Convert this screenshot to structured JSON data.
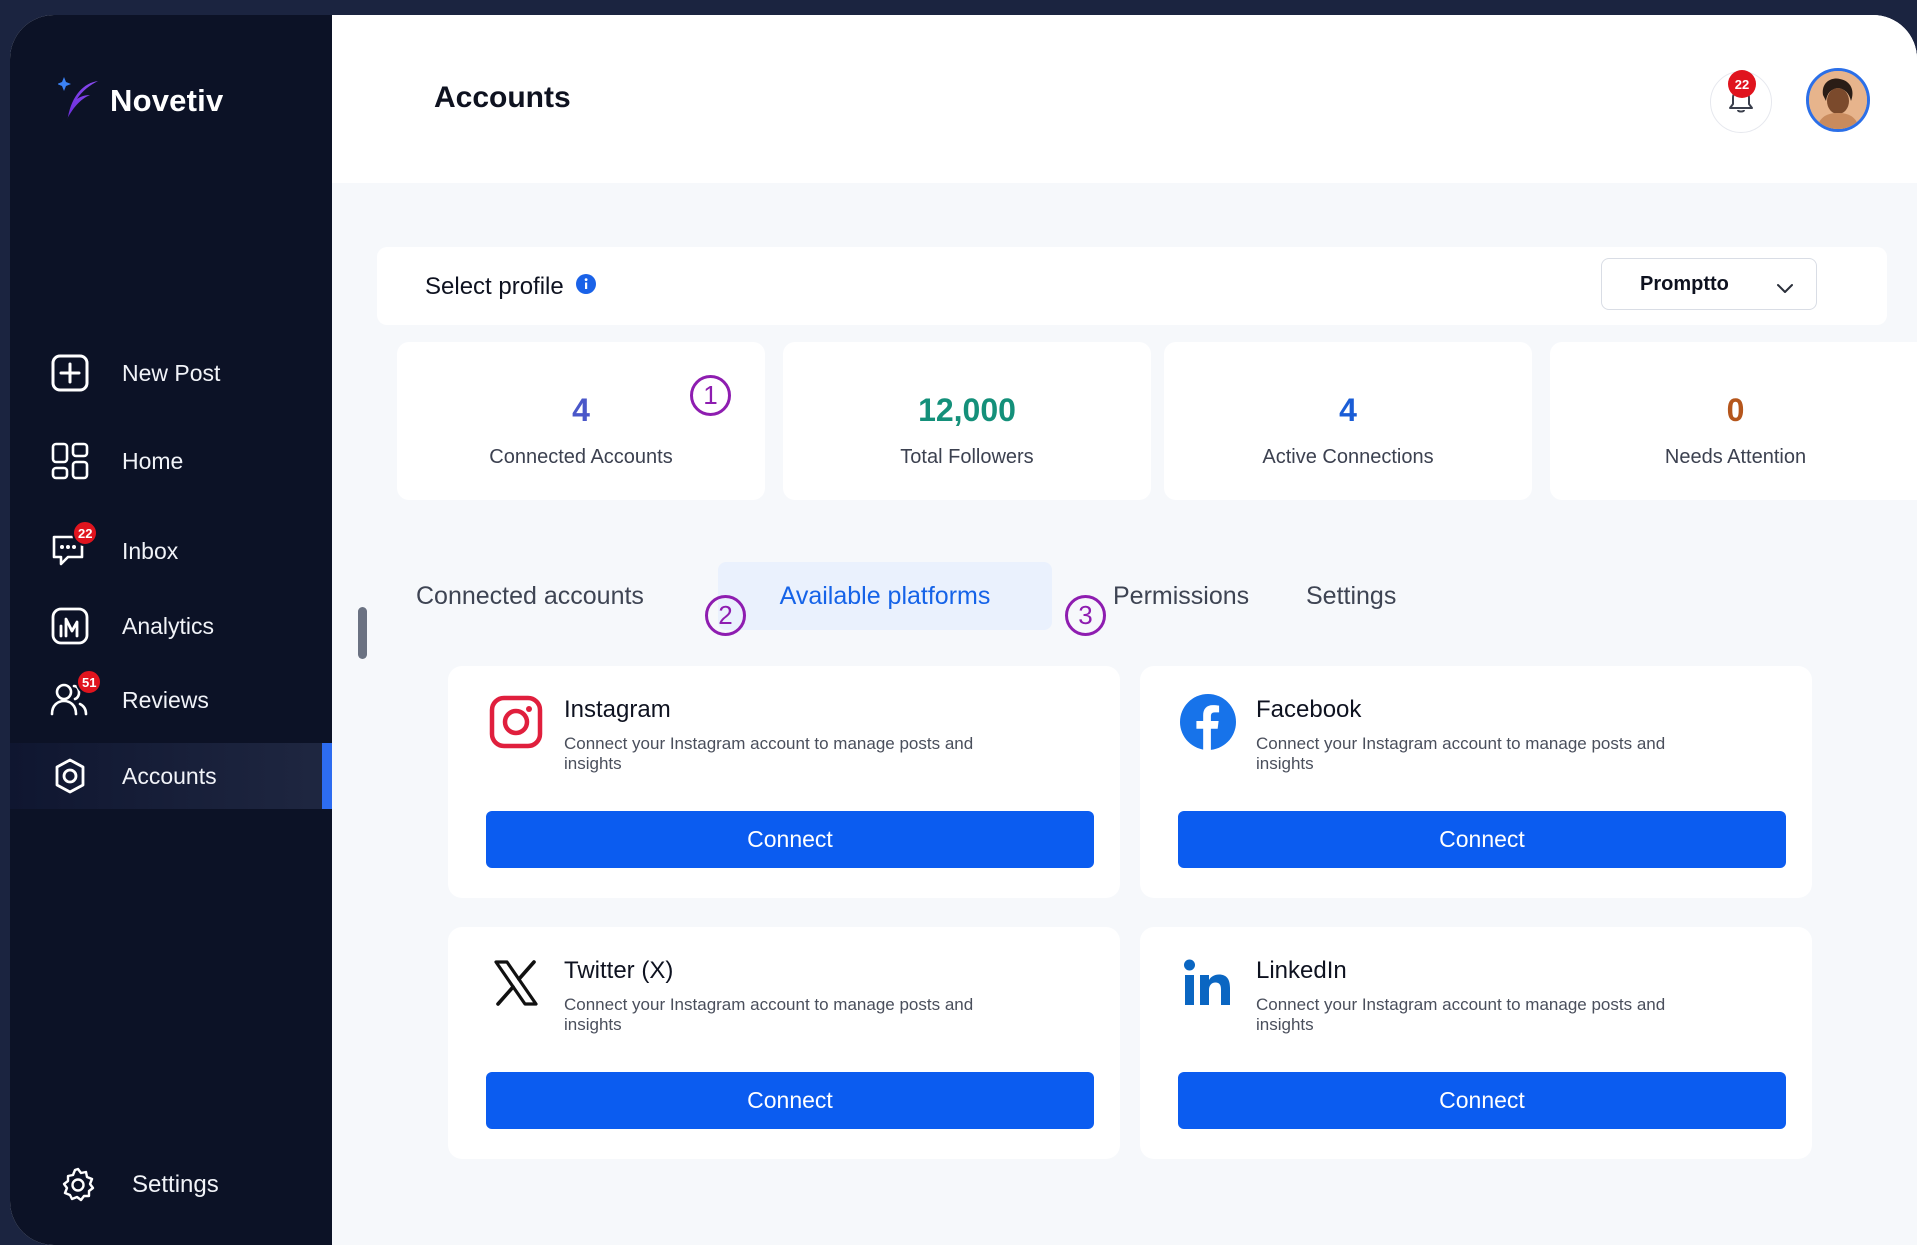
{
  "app": {
    "name": "Novetiv"
  },
  "colors": {
    "sidebar_bg": "#0c1226",
    "accent": "#0b5cf0",
    "active_indicator": "#2d6cf0",
    "badge": "#e0141e",
    "step_marker": "#8e1db0"
  },
  "sidebar": {
    "items": [
      {
        "label": "New Post",
        "icon": "plus-square-icon"
      },
      {
        "label": "Home",
        "icon": "grid-icon"
      },
      {
        "label": "Inbox",
        "icon": "chat-icon",
        "badge": "22"
      },
      {
        "label": "Analytics",
        "icon": "chart-icon"
      },
      {
        "label": "Reviews",
        "icon": "users-icon",
        "badge": "51"
      },
      {
        "label": "Accounts",
        "icon": "gear-icon",
        "active": true
      }
    ],
    "settings_label": "Settings"
  },
  "header": {
    "title": "Accounts",
    "notification_count": "22"
  },
  "profile": {
    "label": "Select profile",
    "selected": "Promptto"
  },
  "stats": [
    {
      "value": "4",
      "label": "Connected Accounts",
      "color": "#4a57c9"
    },
    {
      "value": "12,000",
      "label": "Total Followers",
      "color": "#14907a"
    },
    {
      "value": "4",
      "label": "Active Connections",
      "color": "#1a5dd6"
    },
    {
      "value": "0",
      "label": "Needs Attention",
      "color": "#b5561c"
    }
  ],
  "step_markers": [
    "1",
    "2",
    "3"
  ],
  "tabs": [
    {
      "label": "Connected accounts"
    },
    {
      "label": "Available platforms",
      "active": true
    },
    {
      "label": "Permissions"
    },
    {
      "label": "Settings"
    }
  ],
  "platforms": [
    {
      "name": "Instagram",
      "icon": "instagram-icon",
      "description": "Connect your Instagram account to  manage posts and insights",
      "button": "Connect"
    },
    {
      "name": "Facebook",
      "icon": "facebook-icon",
      "description": "Connect your Instagram account to  manage posts and insights",
      "button": "Connect"
    },
    {
      "name": "Twitter (X)",
      "icon": "x-twitter-icon",
      "description": "Connect your Instagram account to  manage posts and insights",
      "button": "Connect"
    },
    {
      "name": "LinkedIn",
      "icon": "linkedin-icon",
      "description": "Connect your Instagram account to  manage posts and insights",
      "button": "Connect"
    }
  ]
}
